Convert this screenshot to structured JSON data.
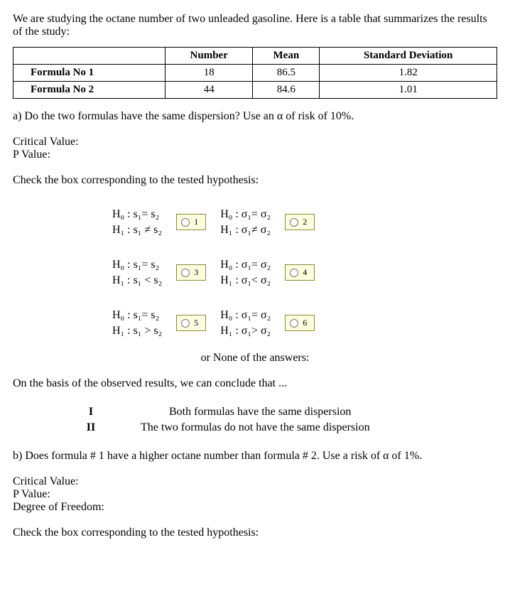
{
  "intro": "We are studying the octane number of two unleaded gasoline. Here is a table that summarizes the results of the study:",
  "table": {
    "headers": [
      "",
      "Number",
      "Mean",
      "Standard Deviation"
    ],
    "rows": [
      {
        "label": "Formula No 1",
        "number": "18",
        "mean": "86.5",
        "sd": "1.82"
      },
      {
        "label": "Formula No 2",
        "number": "44",
        "mean": "84.6",
        "sd": "1.01"
      }
    ]
  },
  "part_a": {
    "question": "a) Do the two formulas have the same dispersion? Use an α of risk of 10%.",
    "cv_label": "Critical Value:",
    "pv_label": "P Value:",
    "instruction": "Check the box corresponding to the tested hypothesis:",
    "hypotheses": [
      {
        "h0": "H₀ : s₁= s₂",
        "h1": "H₁ : s₁ ≠ s₂",
        "num": "1"
      },
      {
        "h0": "H₀ : σ₁= σ₂",
        "h1": "H₁ : σ₁≠ σ₂",
        "num": "2"
      },
      {
        "h0": "H₀ : s₁= s₂",
        "h1": "H₁ : s₁ < s₂",
        "num": "3"
      },
      {
        "h0": "H₀ : σ₁= σ₂",
        "h1": "H₁ : σ₁< σ₂",
        "num": "4"
      },
      {
        "h0": "H₀ : s₁= s₂",
        "h1": "H₁ : s₁ > s₂",
        "num": "5"
      },
      {
        "h0": "H₀ : σ₁= σ₂",
        "h1": "H₁ : σ₁> σ₂",
        "num": "6"
      }
    ],
    "none_text": "or None of the answers:",
    "conclusion_intro": "On the basis of the observed results, we can conclude that ...",
    "conclusions": [
      {
        "num": "I",
        "text": "Both formulas have the same dispersion"
      },
      {
        "num": "II",
        "text": "The two formulas do not have the same dispersion"
      }
    ]
  },
  "part_b": {
    "question": "b) Does formula # 1 have a higher octane number than formula # 2. Use a risk of α of 1%.",
    "cv_label": "Critical Value:",
    "pv_label": "P Value:",
    "df_label": "Degree of Freedom:",
    "instruction": "Check the box corresponding to the tested hypothesis:"
  }
}
